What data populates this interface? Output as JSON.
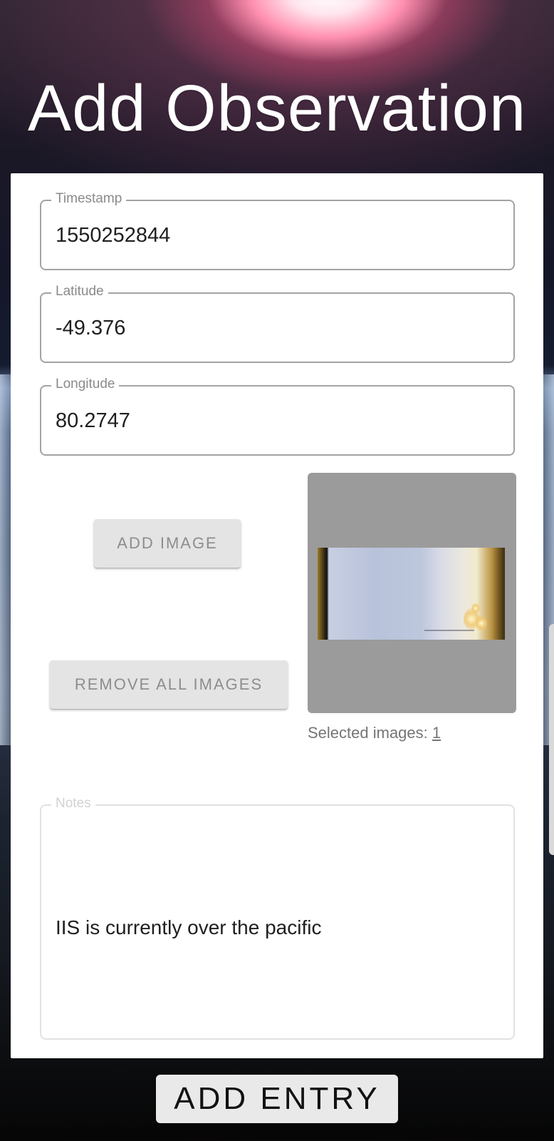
{
  "page_title": "Add Observation",
  "form": {
    "timestamp": {
      "label": "Timestamp",
      "value": "1550252844"
    },
    "latitude": {
      "label": "Latitude",
      "value": "-49.376"
    },
    "longitude": {
      "label": "Longitude",
      "value": "80.2747"
    },
    "add_image_label": "ADD IMAGE",
    "remove_all_images_label": "REMOVE ALL IMAGES",
    "selected_images_prefix": "Selected images: ",
    "selected_images_count": "1",
    "notes": {
      "label": "Notes",
      "value": "IIS is currently over the pacific"
    }
  },
  "add_entry_label": "ADD ENTRY",
  "colors": {
    "card_background": "#ffffff",
    "button_background": "#e4e4e4",
    "preview_background": "#9b9b9b"
  }
}
